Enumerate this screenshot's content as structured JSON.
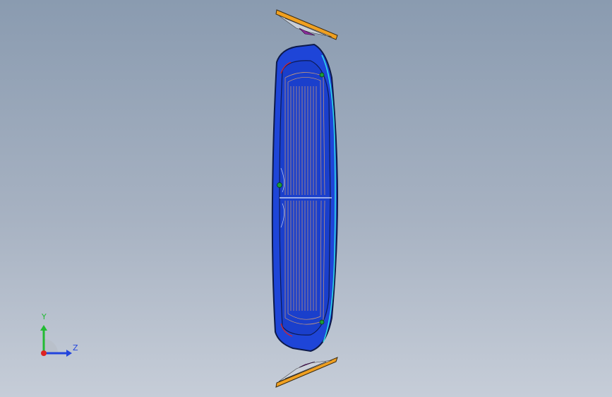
{
  "viewport": {
    "model": "windshield-heater-panel",
    "background_top": "#8a9bb0",
    "background_bottom": "#c6cdd8"
  },
  "colors": {
    "panel_fill": "#1e45d8",
    "panel_edge": "#0d1a4a",
    "trace": "#e6a96b",
    "cyan_edge": "#2fd7e8",
    "bracket": "#f0a020",
    "bracket_accent": "#8b2c9c"
  },
  "triad": {
    "y_label": "Y",
    "z_label": "Z",
    "y_color": "#22bb33",
    "z_color": "#2244dd",
    "x_color": "#dd2222"
  }
}
